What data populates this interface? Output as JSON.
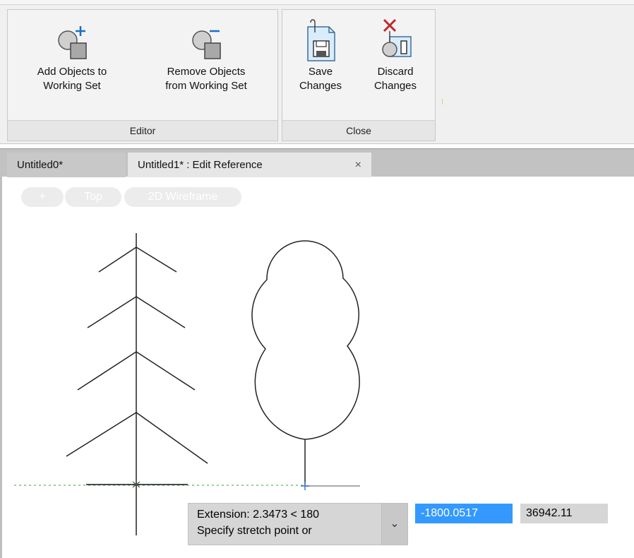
{
  "ribbon": {
    "panels": [
      {
        "title": "Editor",
        "buttons": [
          {
            "label": "Add Objects to\nWorking Set",
            "icon": "add-objects-icon"
          },
          {
            "label": "Remove Objects\nfrom Working Set",
            "icon": "remove-objects-icon"
          }
        ]
      },
      {
        "title": "Close",
        "buttons": [
          {
            "label": "Save\nChanges",
            "icon": "save-changes-icon"
          },
          {
            "label": "Discard\nChanges",
            "icon": "discard-changes-icon"
          }
        ]
      }
    ]
  },
  "tabs": [
    {
      "label": "Untitled0*",
      "active": false
    },
    {
      "label": "Untitled1* : Edit Reference",
      "active": true,
      "close": "×"
    }
  ],
  "viewport": {
    "controls": [
      "+",
      "Top",
      "2D Wireframe"
    ]
  },
  "dynamic_input": {
    "line1": "Extension:  2.3473 < 180",
    "line2": "Specify stretch point or",
    "dropdown_glyph": "⌄",
    "value1": "-1800.0517",
    "value2": "36942.11"
  },
  "colors": {
    "accent": "#3399ff",
    "discard_x": "#c0272d",
    "icon_blue": "#1a6fc9",
    "baseline_guide": "#4caf50"
  }
}
